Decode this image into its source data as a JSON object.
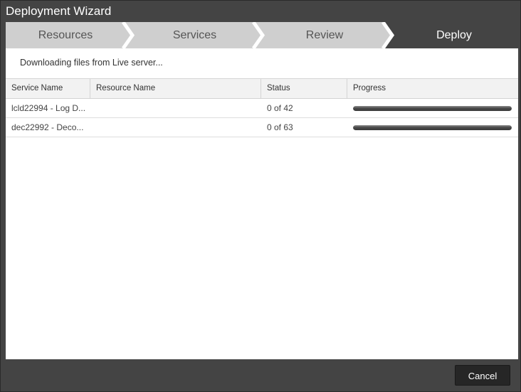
{
  "window": {
    "title": "Deployment Wizard"
  },
  "steps": [
    {
      "label": "Resources",
      "active": false
    },
    {
      "label": "Services",
      "active": false
    },
    {
      "label": "Review",
      "active": false
    },
    {
      "label": "Deploy",
      "active": true
    }
  ],
  "colors": {
    "step_active": "#444444",
    "step_inactive": "#cfcfcf",
    "chevron": "#ffffff"
  },
  "message": "Downloading files from Live server...",
  "grid": {
    "columns": [
      "Service Name",
      "Resource Name",
      "Status",
      "Progress"
    ],
    "rows": [
      {
        "service": "lcld22994 - Log D...",
        "resource": "",
        "status": "0 of 42",
        "progress": 1.0
      },
      {
        "service": "dec22992 - Deco...",
        "resource": "",
        "status": "0 of 63",
        "progress": 1.0
      }
    ]
  },
  "footer": {
    "cancel_label": "Cancel"
  }
}
